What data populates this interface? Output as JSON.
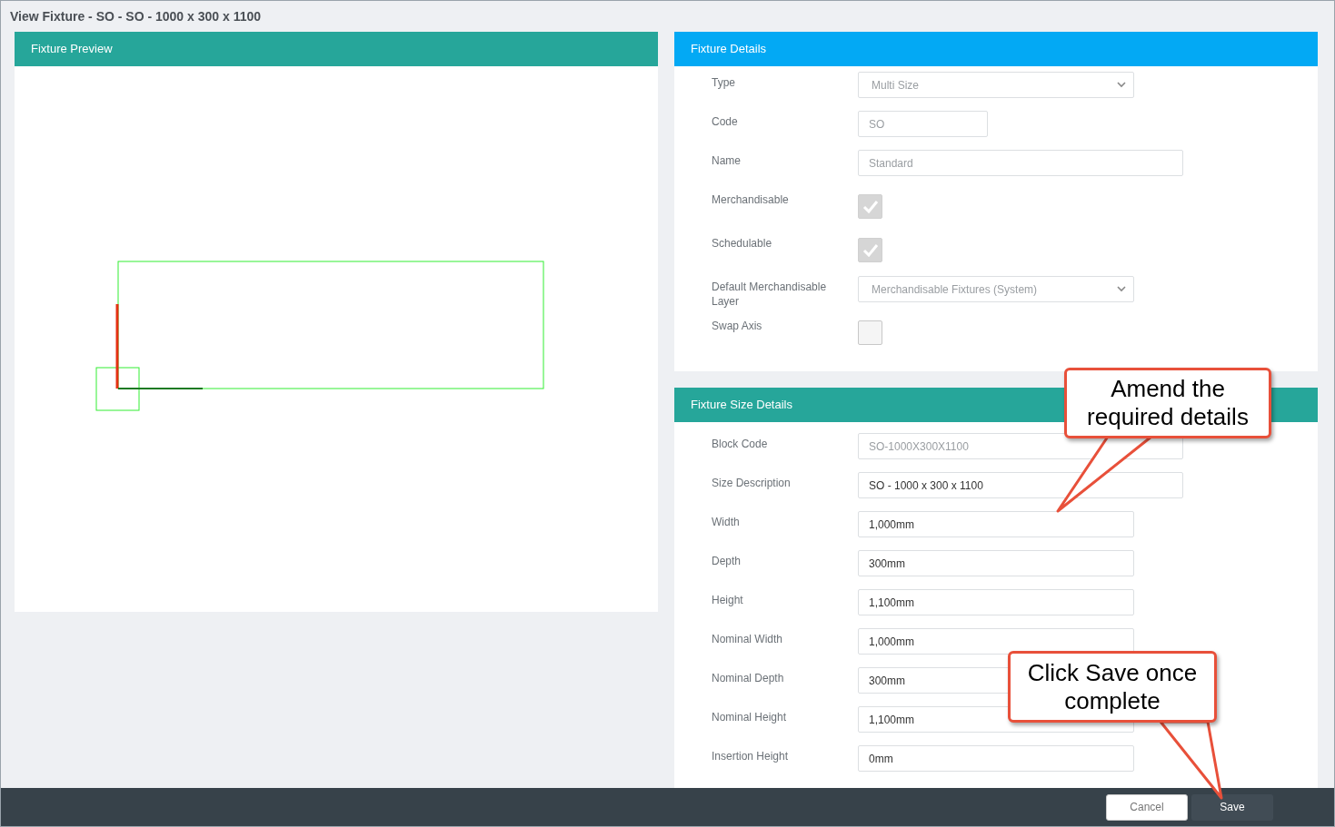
{
  "window": {
    "title": "View Fixture - SO - SO - 1000 x 300 x 1100"
  },
  "preview": {
    "title": "Fixture Preview"
  },
  "details": {
    "title": "Fixture Details",
    "fields": [
      {
        "kind": "select",
        "label": "Type",
        "value": "Multi Size",
        "disabled": true
      },
      {
        "kind": "text",
        "label": "Code",
        "value": "SO",
        "disabled": true
      },
      {
        "kind": "text",
        "label": "Name",
        "value": "Standard",
        "disabled": true
      },
      {
        "kind": "checkbox",
        "label": "Merchandisable",
        "checked": true,
        "disabled": true
      },
      {
        "kind": "checkbox",
        "label": "Schedulable",
        "checked": true,
        "disabled": true
      },
      {
        "kind": "select",
        "label": "Default Merchandisable Layer",
        "value": "Merchandisable Fixtures (System)",
        "disabled": true
      },
      {
        "kind": "checkbox",
        "label": "Swap Axis",
        "checked": false,
        "disabled": false
      }
    ]
  },
  "size_details": {
    "title": "Fixture Size Details",
    "fields": [
      {
        "kind": "text",
        "label": "Block Code",
        "value": "SO-1000X300X1100",
        "disabled": true
      },
      {
        "kind": "text",
        "label": "Size Description",
        "value": "SO - 1000 x 300 x 1100",
        "disabled": false
      },
      {
        "kind": "text",
        "label": "Width",
        "value": "1,000mm",
        "disabled": false
      },
      {
        "kind": "text",
        "label": "Depth",
        "value": "300mm",
        "disabled": false
      },
      {
        "kind": "text",
        "label": "Height",
        "value": "1,100mm",
        "disabled": false
      },
      {
        "kind": "text",
        "label": "Nominal Width",
        "value": "1,000mm",
        "disabled": false
      },
      {
        "kind": "text",
        "label": "Nominal Depth",
        "value": "300mm",
        "disabled": false
      },
      {
        "kind": "text",
        "label": "Nominal Height",
        "value": "1,100mm",
        "disabled": false
      },
      {
        "kind": "text",
        "label": "Insertion Height",
        "value": "0mm",
        "disabled": false
      }
    ]
  },
  "footer": {
    "buttons": [
      {
        "label": "Cancel",
        "kind": "secondary"
      },
      {
        "label": "Save",
        "kind": "primary"
      }
    ]
  },
  "callouts": [
    {
      "text": "Amend the required details"
    },
    {
      "text": "Click Save once complete"
    }
  ]
}
